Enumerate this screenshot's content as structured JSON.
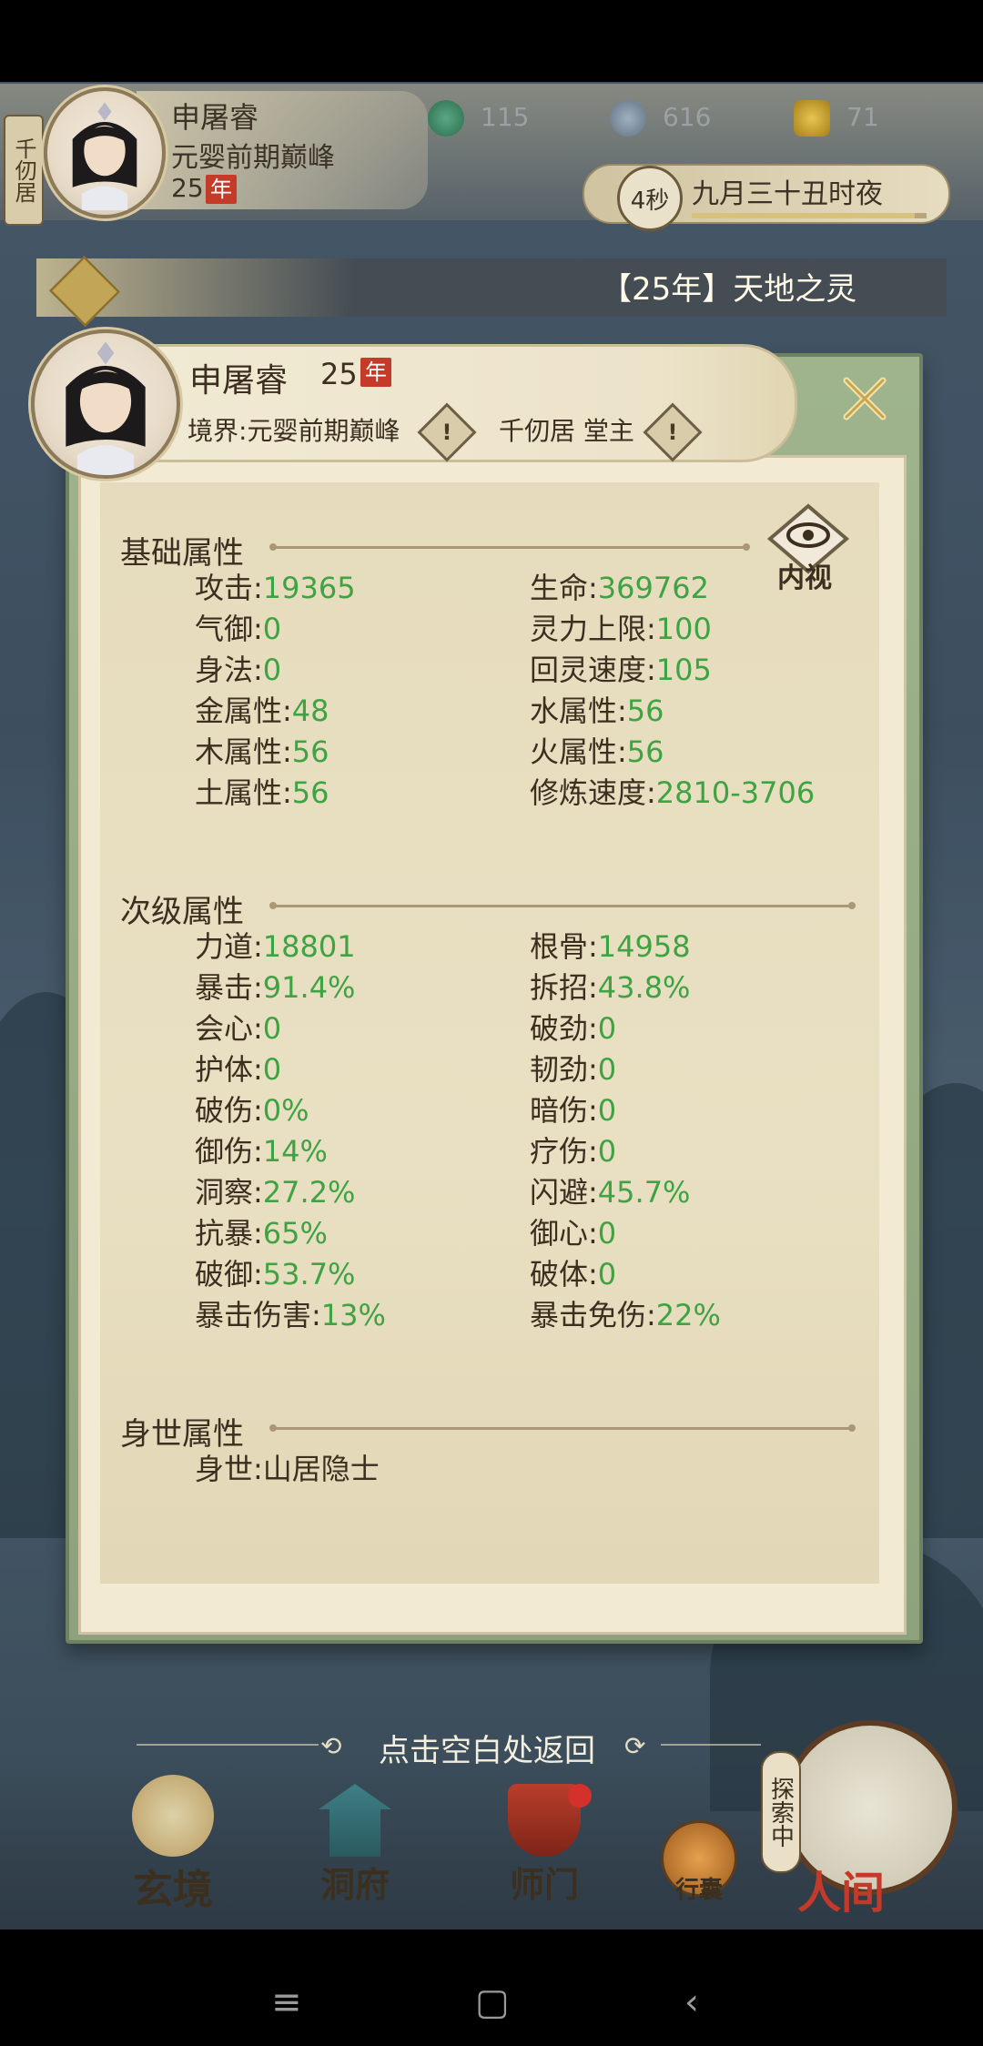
{
  "hud": {
    "sect_tag": "千仞居",
    "player_name": "申屠睿",
    "realm": "元婴前期巅峰",
    "age": "25",
    "age_unit": "年",
    "resources": [
      {
        "icon": "jade-icon",
        "value": "115"
      },
      {
        "icon": "coin-icon",
        "value": "616"
      },
      {
        "icon": "ingot-icon",
        "value": "71"
      }
    ],
    "timer": "4秒",
    "game_date": "九月三十丑时夜",
    "time_progress": 0.95
  },
  "marquee": {
    "text": "【25年】天地之灵"
  },
  "dialog": {
    "name": "申屠睿",
    "age": "25",
    "age_unit": "年",
    "realm_label": "境界:",
    "realm_value": "元婴前期巅峰",
    "sect_title": "千仞居 堂主",
    "info_glyph": "!",
    "inner_view_label": "内视",
    "sections": [
      {
        "title": "基础属性",
        "rows": [
          {
            "left": {
              "k": "攻击",
              "v": "19365"
            },
            "right": {
              "k": "生命",
              "v": "369762"
            }
          },
          {
            "left": {
              "k": "气御",
              "v": "0"
            },
            "right": {
              "k": "灵力上限",
              "v": "100"
            }
          },
          {
            "left": {
              "k": "身法",
              "v": "0"
            },
            "right": {
              "k": "回灵速度",
              "v": "105"
            }
          },
          {
            "left": {
              "k": "金属性",
              "v": "48"
            },
            "right": {
              "k": "水属性",
              "v": "56"
            }
          },
          {
            "left": {
              "k": "木属性",
              "v": "56"
            },
            "right": {
              "k": "火属性",
              "v": "56"
            }
          },
          {
            "left": {
              "k": "土属性",
              "v": "56"
            },
            "right": {
              "k": "修炼速度",
              "v": "2810-3706"
            }
          }
        ]
      },
      {
        "title": "次级属性",
        "rows": [
          {
            "left": {
              "k": "力道",
              "v": "18801"
            },
            "right": {
              "k": "根骨",
              "v": "14958"
            }
          },
          {
            "left": {
              "k": "暴击",
              "v": "91.4%"
            },
            "right": {
              "k": "拆招",
              "v": "43.8%"
            }
          },
          {
            "left": {
              "k": "会心",
              "v": "0"
            },
            "right": {
              "k": "破劲",
              "v": "0"
            }
          },
          {
            "left": {
              "k": "护体",
              "v": "0"
            },
            "right": {
              "k": "韧劲",
              "v": "0"
            }
          },
          {
            "left": {
              "k": "破伤",
              "v": "0%"
            },
            "right": {
              "k": "暗伤",
              "v": "0"
            }
          },
          {
            "left": {
              "k": "御伤",
              "v": "14%"
            },
            "right": {
              "k": "疗伤",
              "v": "0"
            }
          },
          {
            "left": {
              "k": "洞察",
              "v": "27.2%"
            },
            "right": {
              "k": "闪避",
              "v": "45.7%"
            }
          },
          {
            "left": {
              "k": "抗暴",
              "v": "65%"
            },
            "right": {
              "k": "御心",
              "v": "0"
            }
          },
          {
            "left": {
              "k": "破御",
              "v": "53.7%"
            },
            "right": {
              "k": "破体",
              "v": "0"
            }
          },
          {
            "left": {
              "k": "暴击伤害",
              "v": "13%"
            },
            "right": {
              "k": "暴击免伤",
              "v": "22%"
            }
          }
        ]
      },
      {
        "title": "身世属性",
        "rows": [
          {
            "left": {
              "k": "身世",
              "v": "山居隐士"
            }
          }
        ]
      }
    ]
  },
  "back_hint": "点击空白处返回",
  "bottom_nav": {
    "items": [
      "玄境",
      "洞府",
      "师门",
      "行囊"
    ],
    "world_label": "人间",
    "explore_label": "探索中"
  },
  "colors": {
    "value_green": "#3fa243",
    "year_badge_red": "#c53b2a"
  }
}
